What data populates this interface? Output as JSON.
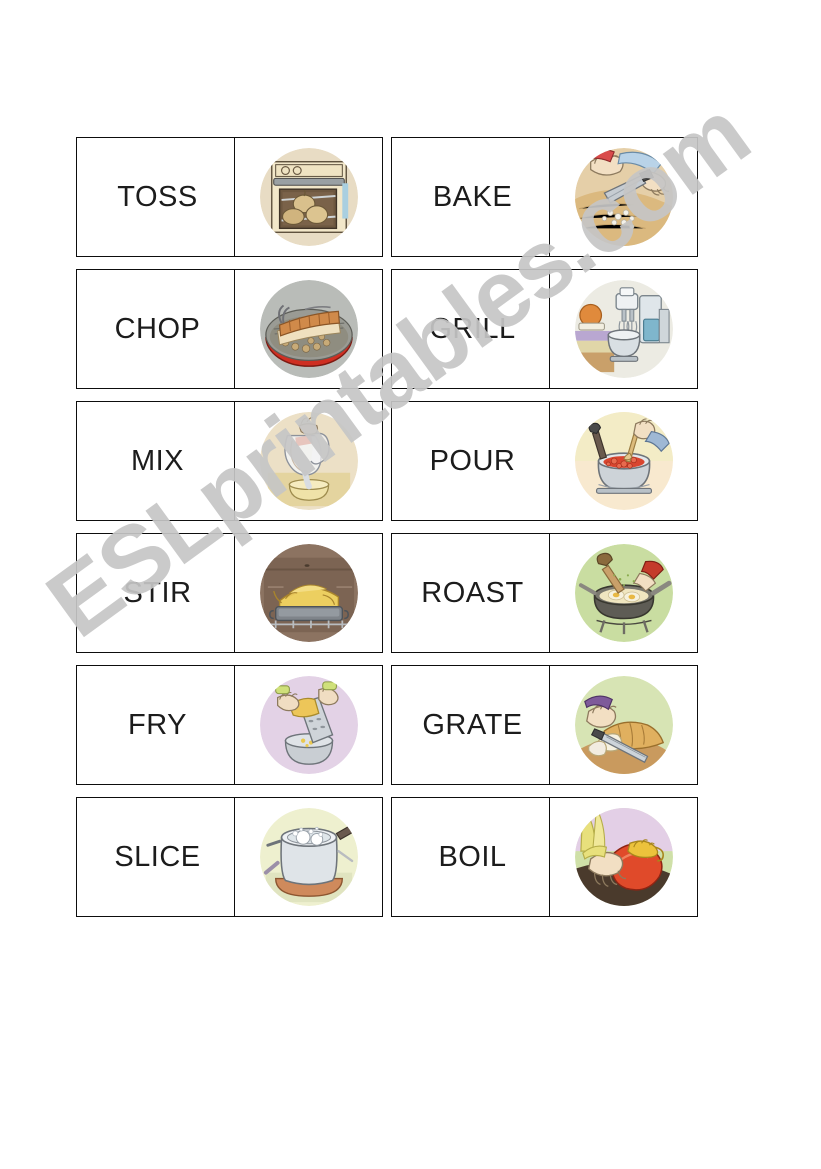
{
  "page": {
    "title": "Cooking Verbs Domino Cards",
    "background_color": "#ffffff",
    "border_color": "#0d0d0d",
    "text_color": "#1c1c1c"
  },
  "watermark": {
    "text": "ESLprintables.com",
    "color": "#c6c6c6",
    "rotation_degrees": -36
  },
  "columns": [
    {
      "name": "left-column",
      "cards": [
        {
          "word": "TOSS",
          "picture_name": "oven-with-baked-potatoes-illustration",
          "picture_alt": "Potatoes baking on a rack inside an open cream-coloured oven",
          "bg_color": "#e8dcc4"
        },
        {
          "word": "CHOP",
          "picture_name": "barbecue-grill-with-steak-illustration",
          "picture_alt": "Steak and tongs on a red charcoal barbecue grill",
          "bg_color": "#b9bcb8"
        },
        {
          "word": "MIX",
          "picture_name": "pouring-jug-into-bowl-illustration",
          "picture_alt": "Hand pouring liquid from a glass jug into a yellow bowl",
          "bg_color": "#ece0c6"
        },
        {
          "word": "STIR",
          "picture_name": "roast-chicken-in-oven-illustration",
          "picture_alt": "Whole roast chicken in a roasting tin inside an oven",
          "bg_color": "#8c7361"
        },
        {
          "word": "FRY",
          "picture_name": "grating-cheese-into-bowl-illustration",
          "picture_alt": "Hands grating yellow cheese on a box grater over a bowl",
          "bg_color": "#e3d2e6"
        },
        {
          "word": "SLICE",
          "picture_name": "boiling-pot-on-stove-illustration",
          "picture_alt": "Pot of boiling water with bubbles on a stove",
          "bg_color": "#eef0cf"
        }
      ]
    },
    {
      "name": "right-column",
      "cards": [
        {
          "word": "BAKE",
          "picture_name": "chopping-onion-with-knife-illustration",
          "picture_alt": "Hands chopping onion with a large knife on a wooden board",
          "bg_color": "#e5cfa8"
        },
        {
          "word": "GRILL",
          "picture_name": "electric-mixer-bowl-illustration",
          "picture_alt": "Electric hand mixer with beaters over a metal mixing bowl",
          "bg_color": "#ecebe3"
        },
        {
          "word": "POUR",
          "picture_name": "stirring-tomato-sauce-pot-illustration",
          "picture_alt": "Hand stirring red tomato sauce in a saucepan with a wooden spoon",
          "bg_color": "#f8e9cf"
        },
        {
          "word": "ROAST",
          "picture_name": "frying-eggs-in-pan-illustration",
          "picture_alt": "Eggs frying in a pan on a gas burner",
          "bg_color": "#c9dda1"
        },
        {
          "word": "GRATE",
          "picture_name": "slicing-bread-loaf-illustration",
          "picture_alt": "Hand slicing a loaf of bread with a bread knife",
          "bg_color": "#d7e4b4"
        },
        {
          "word": "BOIL",
          "picture_name": "squeezing-orange-juicer-illustration",
          "picture_alt": "Hands squeezing an orange on a citrus juicer",
          "bg_color": "#cfe0a8"
        }
      ]
    }
  ]
}
